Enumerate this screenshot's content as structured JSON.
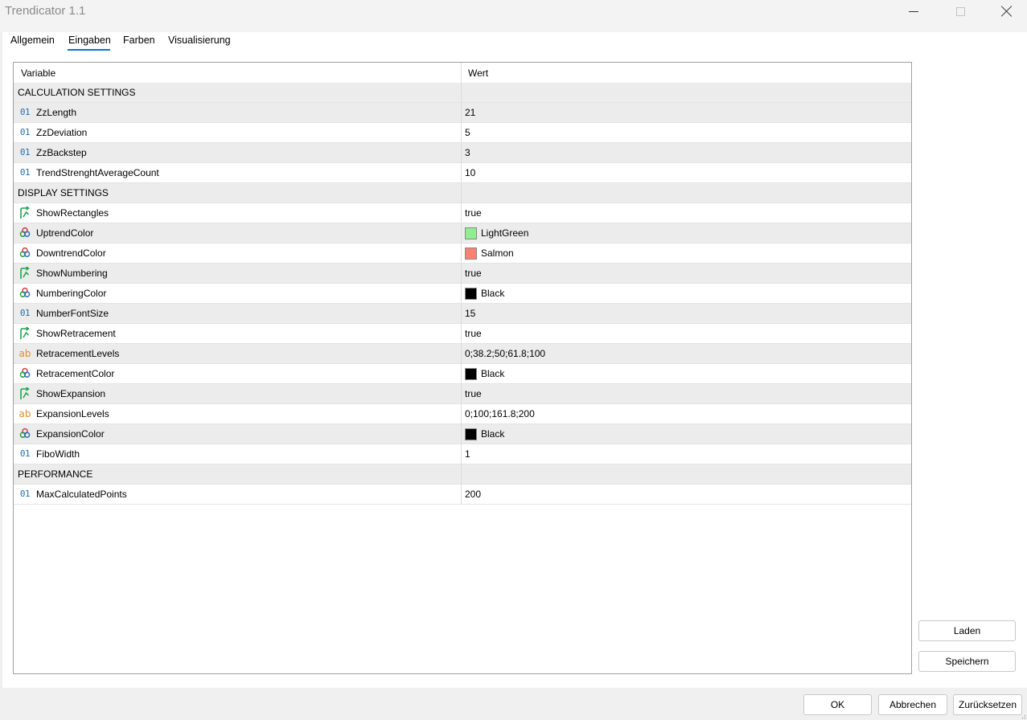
{
  "window": {
    "title": "Trendicator 1.1"
  },
  "tabs": [
    "Allgemein",
    "Eingaben",
    "Farben",
    "Visualisierung"
  ],
  "active_tab": "Eingaben",
  "grid": {
    "columns": {
      "variable": "Variable",
      "value": "Wert"
    },
    "rows": [
      {
        "type": "section",
        "name": "CALCULATION SETTINGS"
      },
      {
        "type": "int",
        "icon": "integer-icon",
        "name": "ZzLength",
        "value": "21"
      },
      {
        "type": "int",
        "icon": "integer-icon",
        "name": "ZzDeviation",
        "value": "5"
      },
      {
        "type": "int",
        "icon": "integer-icon",
        "name": "ZzBackstep",
        "value": "3"
      },
      {
        "type": "int",
        "icon": "integer-icon",
        "name": "TrendStrenghtAverageCount",
        "value": "10"
      },
      {
        "type": "section",
        "name": "DISPLAY SETTINGS"
      },
      {
        "type": "bool",
        "icon": "boolean-icon",
        "name": "ShowRectangles",
        "value": "true"
      },
      {
        "type": "color",
        "icon": "color-icon",
        "name": "UptrendColor",
        "value": "LightGreen",
        "swatch": "#90ee90"
      },
      {
        "type": "color",
        "icon": "color-icon",
        "name": "DowntrendColor",
        "value": "Salmon",
        "swatch": "#fa8072"
      },
      {
        "type": "bool",
        "icon": "boolean-icon",
        "name": "ShowNumbering",
        "value": "true"
      },
      {
        "type": "color",
        "icon": "color-icon",
        "name": "NumberingColor",
        "value": "Black",
        "swatch": "#000000"
      },
      {
        "type": "int",
        "icon": "integer-icon",
        "name": "NumberFontSize",
        "value": "15"
      },
      {
        "type": "bool",
        "icon": "boolean-icon",
        "name": "ShowRetracement",
        "value": "true"
      },
      {
        "type": "string",
        "icon": "string-icon",
        "name": "RetracementLevels",
        "value": "0;38.2;50;61.8;100"
      },
      {
        "type": "color",
        "icon": "color-icon",
        "name": "RetracementColor",
        "value": "Black",
        "swatch": "#000000"
      },
      {
        "type": "bool",
        "icon": "boolean-icon",
        "name": "ShowExpansion",
        "value": "true"
      },
      {
        "type": "string",
        "icon": "string-icon",
        "name": "ExpansionLevels",
        "value": "0;100;161.8;200"
      },
      {
        "type": "color",
        "icon": "color-icon",
        "name": "ExpansionColor",
        "value": "Black",
        "swatch": "#000000"
      },
      {
        "type": "int",
        "icon": "integer-icon",
        "name": "FiboWidth",
        "value": "1"
      },
      {
        "type": "section",
        "name": "PERFORMANCE"
      },
      {
        "type": "int",
        "icon": "integer-icon",
        "name": "MaxCalculatedPoints",
        "value": "200"
      }
    ]
  },
  "icon_glyphs": {
    "int": "01",
    "string": "ab"
  },
  "buttons": {
    "load": "Laden",
    "save": "Speichern",
    "ok": "OK",
    "cancel": "Abbrechen",
    "reset": "Zurücksetzen"
  },
  "colors": {
    "accent": "#0078d4",
    "int_icon": "#1e6fb8",
    "string_icon": "#d9902b",
    "bool_icon": "#1fa34a"
  }
}
